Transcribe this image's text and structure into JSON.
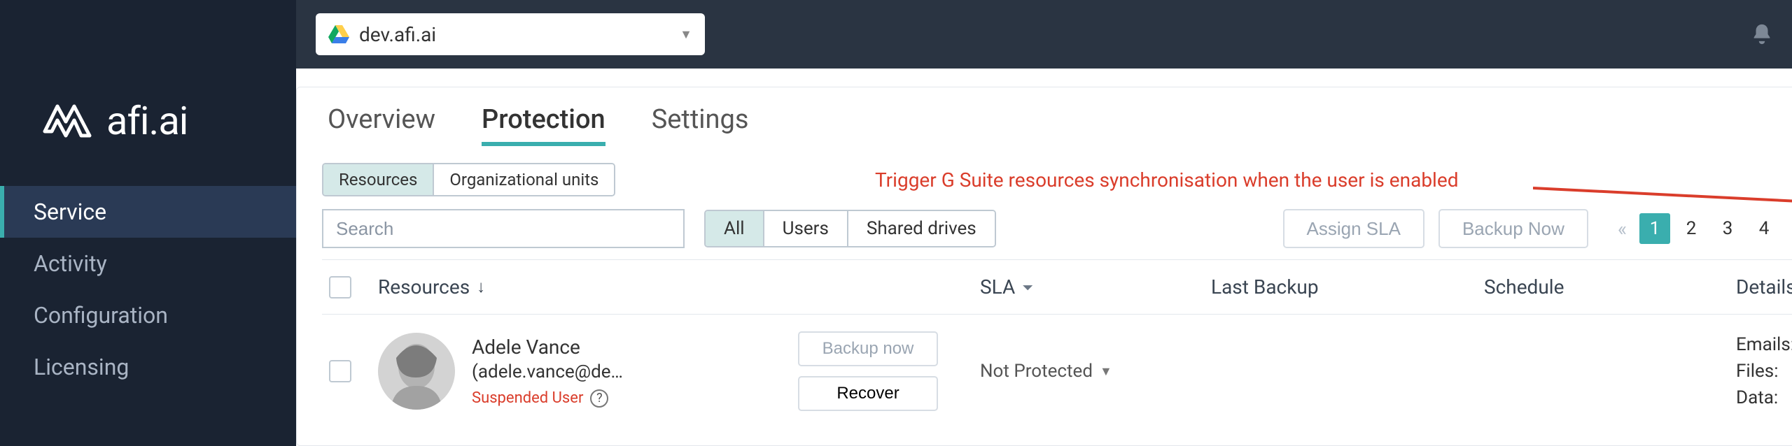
{
  "brand": {
    "name": "afi.ai"
  },
  "sidebar": {
    "items": [
      {
        "label": "Service",
        "active": true
      },
      {
        "label": "Activity",
        "active": false
      },
      {
        "label": "Configuration",
        "active": false
      },
      {
        "label": "Licensing",
        "active": false
      }
    ]
  },
  "topbar": {
    "domain": "dev.afi.ai"
  },
  "tabs": [
    {
      "label": "Overview",
      "active": false
    },
    {
      "label": "Protection",
      "active": true
    },
    {
      "label": "Settings",
      "active": false
    }
  ],
  "sub_toggle": [
    {
      "label": "Resources",
      "active": true
    },
    {
      "label": "Organizational units",
      "active": false
    }
  ],
  "search": {
    "placeholder": "Search"
  },
  "filter_pills": [
    {
      "label": "All",
      "active": true
    },
    {
      "label": "Users",
      "active": false
    },
    {
      "label": "Shared drives",
      "active": false
    }
  ],
  "actions": {
    "assign_sla": "Assign SLA",
    "backup_now_top": "Backup Now"
  },
  "pagination": {
    "prev": "«",
    "pages": [
      "1",
      "2",
      "3",
      "4"
    ],
    "active_index": 0,
    "next": "»"
  },
  "annotation": {
    "text": "Trigger G Suite resources synchronisation when the user is enabled"
  },
  "table": {
    "columns": {
      "resources": "Resources",
      "sla": "SLA",
      "last_backup": "Last Backup",
      "schedule": "Schedule",
      "details": "Details"
    },
    "rows": [
      {
        "name": "Adele Vance",
        "email": "(adele.vance@de…",
        "suspended_label": "Suspended User",
        "backup_now": "Backup now",
        "recover": "Recover",
        "sla": "Not Protected",
        "last_backup": "",
        "schedule": "",
        "details": {
          "emails_k": "Emails:",
          "emails_v": "-",
          "files_k": "Files:",
          "files_v": "-",
          "data_k": "Data:",
          "data_v": "-"
        }
      }
    ]
  }
}
